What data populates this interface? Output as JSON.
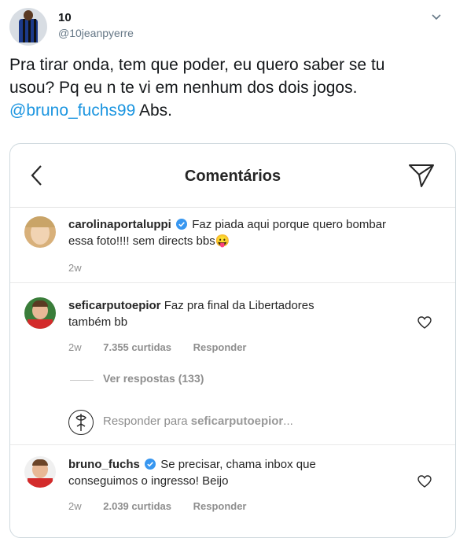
{
  "tweet": {
    "display_name": "10",
    "handle": "@10jeanpyerre",
    "text_line1": "Pra tirar onda, tem que poder, eu quero saber se tu",
    "text_line2": "usou? Pq eu n te vi em nenhum dos dois jogos.",
    "mention": "@bruno_fuchs99",
    "text_end": " Abs."
  },
  "instagram": {
    "title": "Comentários",
    "comments": [
      {
        "user": "carolinaportaluppi",
        "verified": true,
        "text_line1": "Faz piada aqui porque quero bombar",
        "text_line2": "essa foto!!!! sem directs bbs😛",
        "time": "2w"
      },
      {
        "user": "seficarputoepior",
        "verified": false,
        "text_line1": "Faz pra final da Libertadores",
        "text_line2": "também bb",
        "time": "2w",
        "likes": "7.355 curtidas",
        "reply": "Responder"
      },
      {
        "user": "bruno_fuchs",
        "verified": true,
        "text_line1": "Se precisar, chama inbox que",
        "text_line2": "conseguimos o ingresso! Beijo",
        "time": "2w",
        "likes": "2.039 curtidas",
        "reply": "Responder"
      }
    ],
    "view_replies": "Ver respostas (133)",
    "reply_prefix": "Responder para ",
    "reply_target": "seficarputoepior",
    "reply_suffix": "..."
  },
  "colors": {
    "mention": "#1b95e0",
    "verified": "#3897f0",
    "secondary": "#8e8e8e"
  },
  "icons": [
    "chevron-down-icon",
    "back-icon",
    "send-icon",
    "verified-icon",
    "heart-icon"
  ]
}
